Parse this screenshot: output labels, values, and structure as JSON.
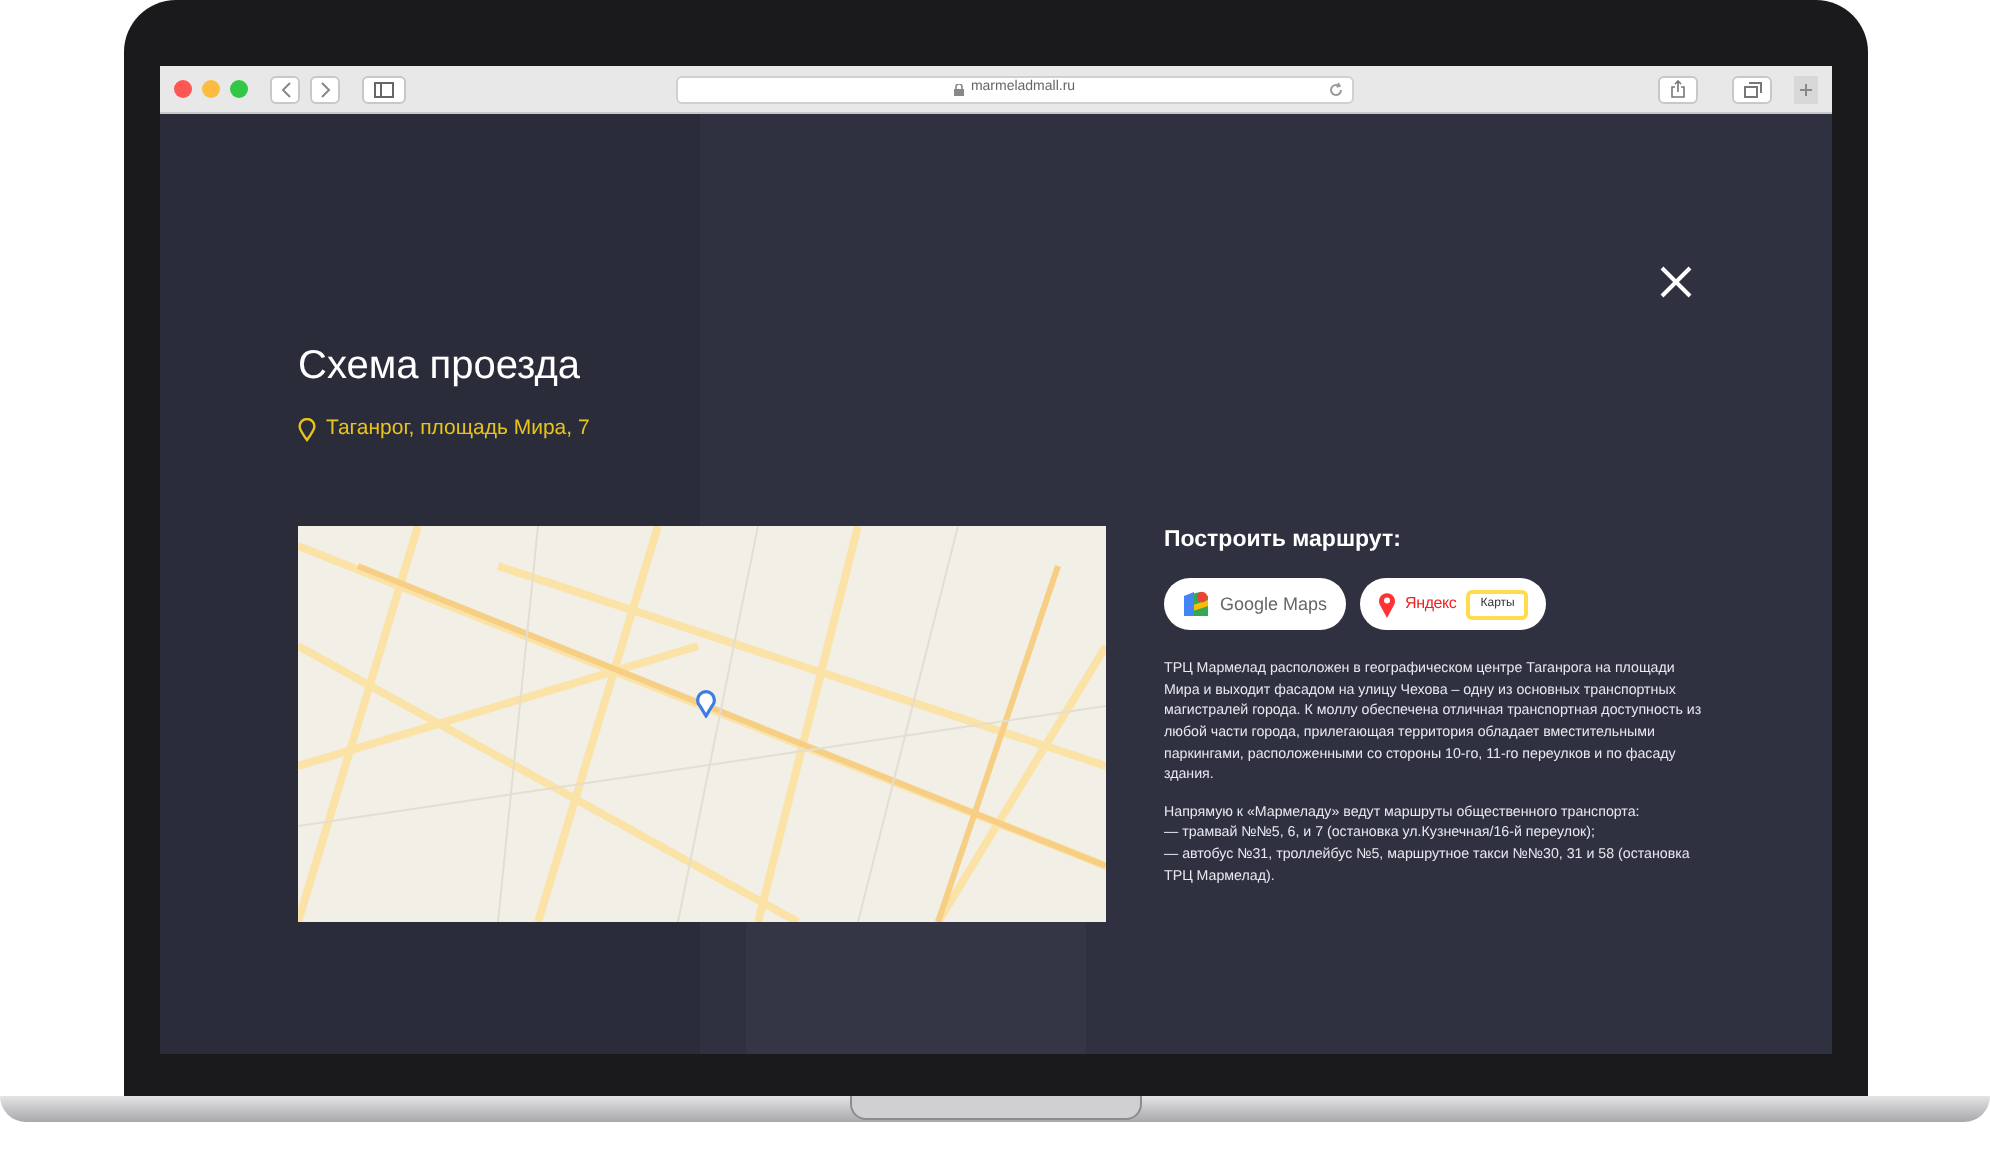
{
  "browser": {
    "url": "marmeladmall.ru"
  },
  "modal": {
    "title": "Схема проезда",
    "address": "Таганрог, площадь Мира, 7",
    "route_heading": "Построить маршрут:",
    "route_buttons": [
      {
        "kind": "google",
        "label": "Google Maps"
      },
      {
        "kind": "yandex",
        "label": "Яндекс",
        "badge": "Карты"
      }
    ],
    "paragraphs": [
      [
        "ТРЦ Мармелад расположен в географическом центре Таганрога на площади Мира и выходит фасадом на улицу Чехова – одну из основных транспортных магистралей города. К моллу обеспечена отличная транспортная доступность из любой части города, прилегающая территория обладает вместительными паркингами, расположенными со стороны 10-го, 11-го переулков и по фасаду здания."
      ],
      [
        "Напрямую к «Мармеладу» ведут маршруты общественного транспорта:",
        "— трамвай №№5, 6, и 7 (остановка ул.Кузнечная/16-й переулок);",
        "— автобус №31, троллейбус №5, маршрутное такси №№30, 31 и 58 (остановка ТРЦ Мармелад)."
      ]
    ]
  }
}
